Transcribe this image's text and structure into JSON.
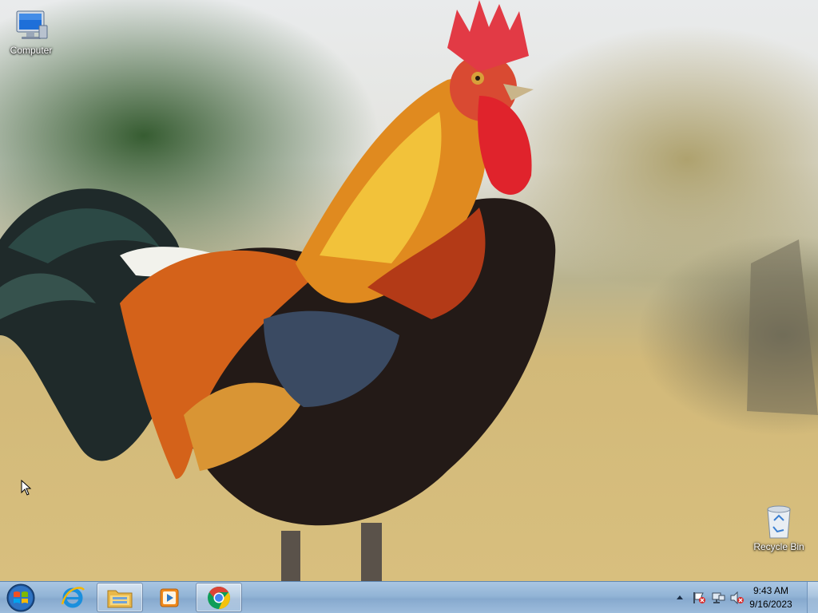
{
  "desktop": {
    "wallpaper": "rooster-wallpaper",
    "icons": {
      "computer": {
        "label": "Computer",
        "icon": "computer-icon"
      },
      "recycle_bin": {
        "label": "Recycle Bin",
        "icon": "recycle-bin-icon"
      }
    }
  },
  "taskbar": {
    "start": {
      "icon": "windows-start-icon"
    },
    "pinned": [
      {
        "name": "Internet Explorer",
        "icon": "internet-explorer-icon",
        "open": false
      },
      {
        "name": "Windows Explorer",
        "icon": "folder-icon",
        "open": true
      },
      {
        "name": "Windows Media Player",
        "icon": "media-player-icon",
        "open": false
      },
      {
        "name": "Google Chrome",
        "icon": "chrome-icon",
        "open": true
      }
    ],
    "tray": {
      "icons": [
        "show-hidden-icons-chevron",
        "action-center-flag-icon",
        "network-icon",
        "volume-muted-icon"
      ],
      "time": "9:43 AM",
      "date": "9/16/2023"
    }
  },
  "colors": {
    "taskbar": "#92b4d6",
    "chrome_red": "#db4437",
    "chrome_yellow": "#f4c20d",
    "chrome_green": "#0f9d58",
    "chrome_blue": "#4285f4"
  }
}
